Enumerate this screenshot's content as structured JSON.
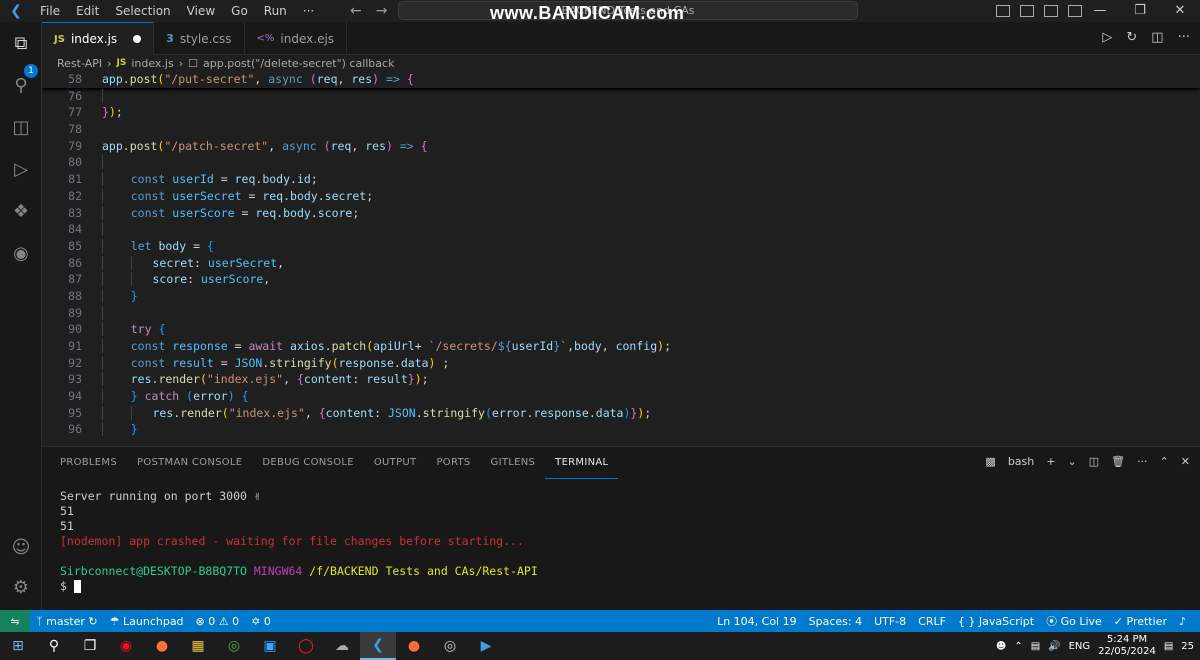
{
  "menu": [
    "File",
    "Edit",
    "Selection",
    "View",
    "Go",
    "Run",
    "···"
  ],
  "command_center": "BACKEND Tests and CAs",
  "watermark": "www.BANDICAM.com",
  "tabs": [
    {
      "icon": "JS",
      "label": "index.js",
      "modified": true
    },
    {
      "icon": "3",
      "label": "style.css"
    },
    {
      "icon": "<%",
      "label": "index.ejs"
    }
  ],
  "breadcrumb": {
    "folder": "Rest-API",
    "file_icon": "JS",
    "file": "index.js",
    "symbol": "app.post(\"/delete-secret\") callback"
  },
  "activity_badge": "1",
  "panel_tabs": [
    "PROBLEMS",
    "POSTMAN CONSOLE",
    "DEBUG CONSOLE",
    "OUTPUT",
    "PORTS",
    "GITLENS",
    "TERMINAL"
  ],
  "terminal_shell": "bash",
  "terminal": {
    "line1": "Server running on port 3000 ✌",
    "line2": "51",
    "line3": "51",
    "line4": "[nodemon] app crashed - waiting for file changes before starting...",
    "prompt_user": "Sirbconnect@DESKTOP-B8BQ7TO",
    "prompt_env": "MINGW64",
    "prompt_path": "/f/BACKEND Tests and CAs/Rest-API",
    "prompt_symbol": "$"
  },
  "status": {
    "branch": "master",
    "launchpad": "Launchpad",
    "errors": "0",
    "warnings": "0",
    "ports": "0",
    "position": "Ln 104, Col 19",
    "spaces": "Spaces: 4",
    "encoding": "UTF-8",
    "eol": "CRLF",
    "language": "JavaScript",
    "golive": "Go Live",
    "prettier": "Prettier"
  },
  "taskbar": {
    "lang": "ENG",
    "time": "5:24 PM",
    "date": "22/05/2024",
    "notif": "25"
  },
  "colors": {
    "accent": "#007acc",
    "editor_bg": "#1f1f1f"
  }
}
